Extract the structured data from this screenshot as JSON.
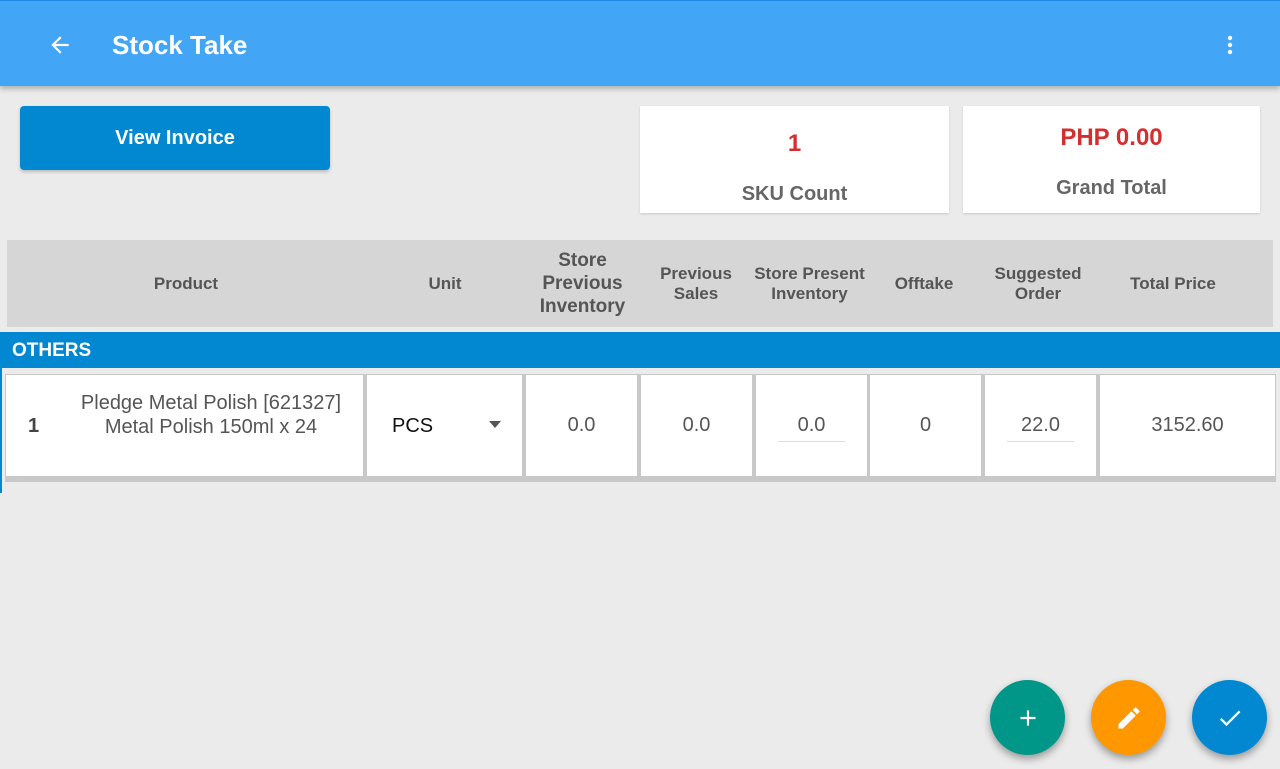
{
  "appbar": {
    "title": "Stock Take"
  },
  "actions": {
    "view_invoice": "View Invoice"
  },
  "summary": {
    "sku_count_value": "1",
    "sku_count_label": "SKU Count",
    "grand_total_value": "PHP 0.00",
    "grand_total_label": "Grand Total"
  },
  "table": {
    "headers": [
      "Product",
      "Unit",
      "Store Previous Inventory",
      "Previous Sales",
      "Store Present Inventory",
      "Offtake",
      "Suggested Order",
      "Total Price"
    ],
    "sections": [
      {
        "name": "OTHERS",
        "rows": [
          {
            "num": "1",
            "product": "Pledge Metal Polish [621327] Metal Polish 150ml x 24",
            "unit": "PCS",
            "store_previous_inventory": "0.0",
            "previous_sales": "0.0",
            "store_present_inventory": "0.0",
            "offtake": "0",
            "suggested_order": "22.0",
            "total_price": "3152.60"
          }
        ]
      }
    ]
  },
  "fabs": {
    "add": "add-icon",
    "edit": "pencil-icon",
    "confirm": "check-icon"
  },
  "colors": {
    "appbar": "#42a5f5",
    "primary": "#0288d1",
    "accent_red": "#d32f2f",
    "fab_add": "#009688",
    "fab_edit": "#ff9800"
  }
}
